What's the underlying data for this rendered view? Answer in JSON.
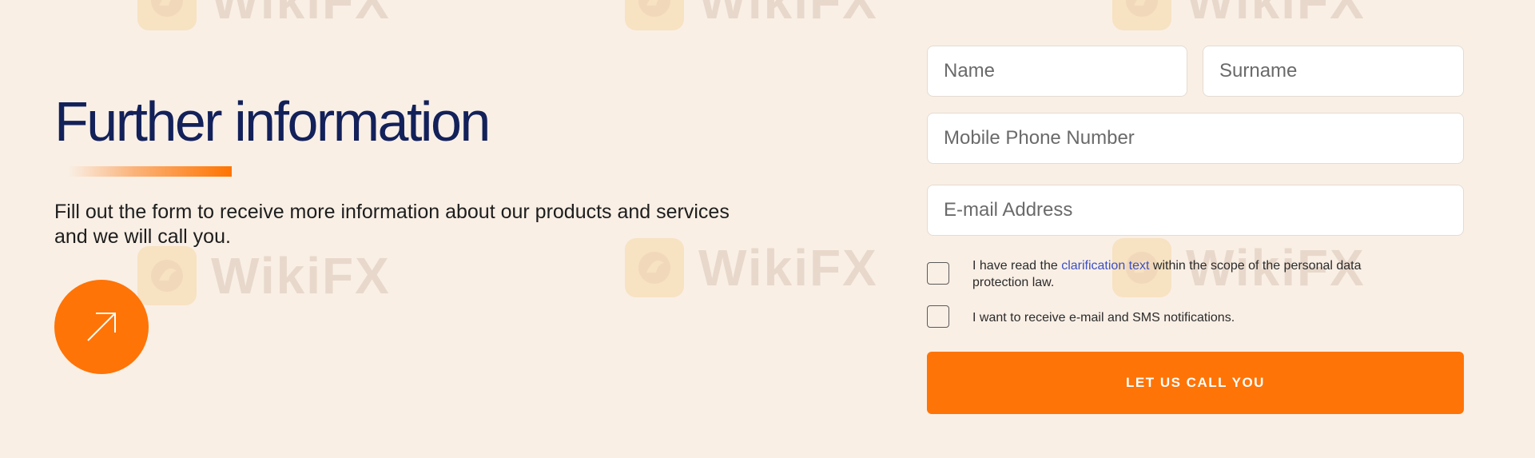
{
  "heading": {
    "title": "Further information",
    "description": "Fill out the form to receive more information about our products and services and we will call you."
  },
  "icons": {
    "arrow": "arrow-up-right-icon",
    "watermark_logo": "eagle-logo-icon"
  },
  "form": {
    "name_placeholder": "Name",
    "surname_placeholder": "Surname",
    "phone_placeholder": "Mobile Phone Number",
    "email_placeholder": "E-mail Address",
    "consent_prefix": "I have read the ",
    "consent_link": "clarification text",
    "consent_suffix": " within the scope of the personal data protection law.",
    "notifications_label": "I want to receive e-mail and SMS notifications.",
    "submit_label": "LET US CALL YOU"
  },
  "watermark": {
    "text": "WikiFX"
  },
  "colors": {
    "background": "#f9efe5",
    "accent": "#ff7406",
    "title": "#13215a",
    "link": "#3c4fc4"
  }
}
